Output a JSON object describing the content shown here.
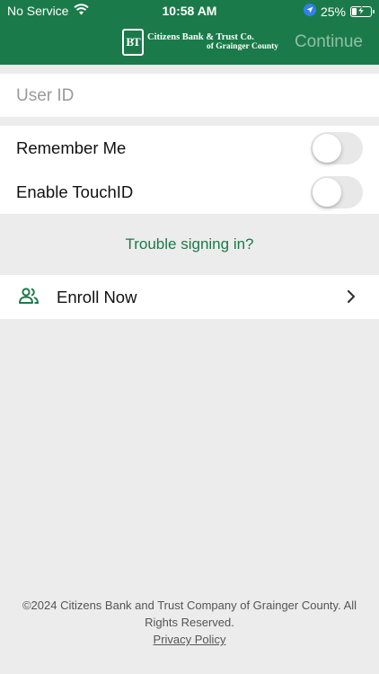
{
  "status_bar": {
    "carrier": "No Service",
    "time": "10:58 AM",
    "battery_text": "25%",
    "battery_level": 0.25
  },
  "header": {
    "logo_initials": "BT",
    "logo_line1": "Citizens Bank & Trust Co.",
    "logo_line2": "of Grainger County",
    "continue_label": "Continue"
  },
  "login": {
    "user_id_placeholder": "User ID",
    "user_id_value": ""
  },
  "toggles": [
    {
      "label": "Remember Me",
      "on": false
    },
    {
      "label": "Enable TouchID",
      "on": false
    }
  ],
  "trouble_link": "Trouble signing in?",
  "enroll": {
    "label": "Enroll Now"
  },
  "footer": {
    "copyright": "©2024 Citizens Bank and Trust Company of Grainger County. All Rights Reserved.",
    "privacy_link": "Privacy Policy"
  },
  "colors": {
    "brand_green": "#1b7a4a",
    "background": "#ececec"
  },
  "icons": [
    "wifi-icon",
    "location-arrow-icon",
    "battery-charging-icon",
    "users-icon",
    "chevron-right-icon"
  ]
}
